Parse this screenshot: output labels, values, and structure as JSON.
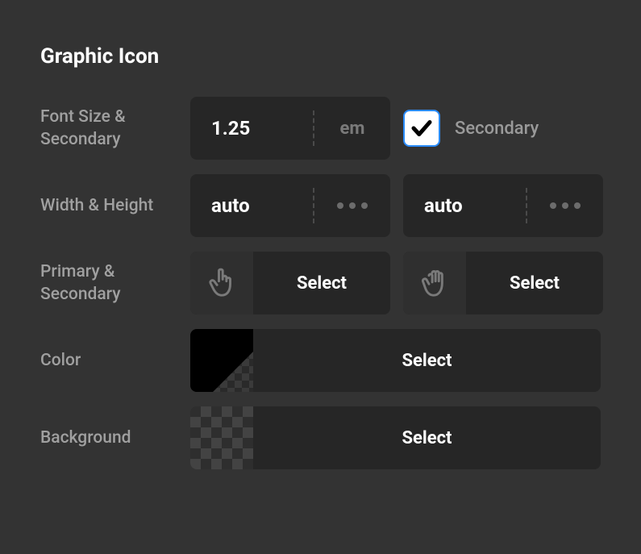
{
  "panel": {
    "title": "Graphic Icon"
  },
  "rows": {
    "fontSize": {
      "label": "Font Size & Secondary",
      "value": "1.25",
      "unit": "em",
      "secondaryChecked": true,
      "secondaryLabel": "Secondary"
    },
    "widthHeight": {
      "label": "Width & Height",
      "width": "auto",
      "height": "auto"
    },
    "primarySecondary": {
      "label": "Primary & Secondary",
      "primarySelect": "Select",
      "secondarySelect": "Select",
      "icons": {
        "primary": "pointer-hand-icon",
        "secondary": "open-hand-icon"
      }
    },
    "color": {
      "label": "Color",
      "value": "#000000",
      "select": "Select"
    },
    "background": {
      "label": "Background",
      "value": "transparent",
      "select": "Select"
    }
  }
}
